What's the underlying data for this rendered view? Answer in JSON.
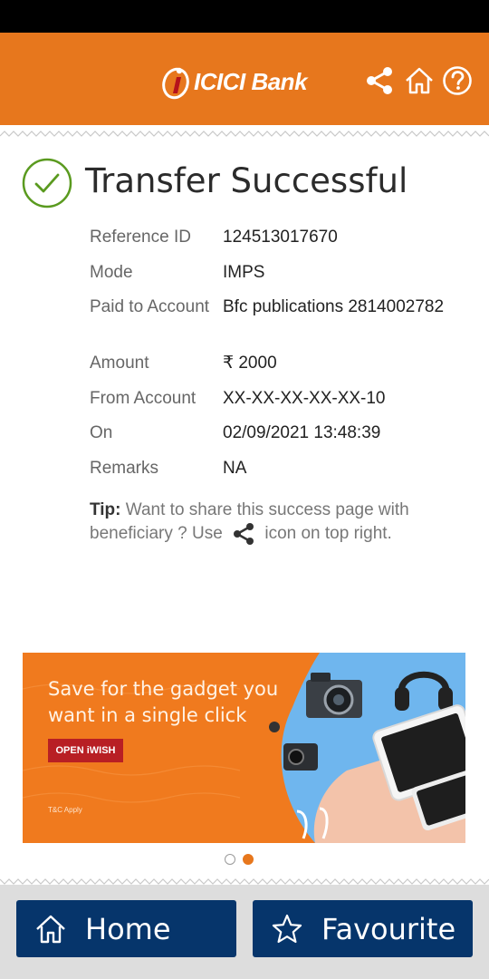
{
  "header": {
    "brand": "ICICI Bank",
    "bg_color": "#e7771d"
  },
  "icons": {
    "share": "share-icon",
    "home": "home-icon",
    "help": "help-icon",
    "success": "check-circle-icon",
    "favourite": "star-icon"
  },
  "status": {
    "title": "Transfer Successful",
    "accent_color": "#5a9a1f"
  },
  "details": [
    {
      "label": "Reference ID",
      "value": "124513017670"
    },
    {
      "label": "Mode",
      "value": "IMPS"
    },
    {
      "label": "Paid to Account",
      "value": "Bfc publications 2814002782"
    },
    {
      "label": "Amount",
      "value": "₹ 2000"
    },
    {
      "label": "From Account",
      "value": "XX-XX-XX-XX-XX-10"
    },
    {
      "label": "On",
      "value": "02/09/2021 13:48:39"
    },
    {
      "label": "Remarks",
      "value": "NA"
    }
  ],
  "tip": {
    "prefix": "Tip:",
    "text_before": "Want to share this success page with beneficiary ? Use",
    "text_after": "icon on top right."
  },
  "banner": {
    "headline": "Save for the gadget you want in a single click",
    "cta": "OPEN iWISH",
    "terms": "T&C Apply",
    "bg_color": "#f07a1e"
  },
  "carousel": {
    "count": 2,
    "active_index": 1
  },
  "bottom_nav": {
    "home_label": "Home",
    "favourite_label": "Favourite",
    "bg_color": "#06356b"
  }
}
